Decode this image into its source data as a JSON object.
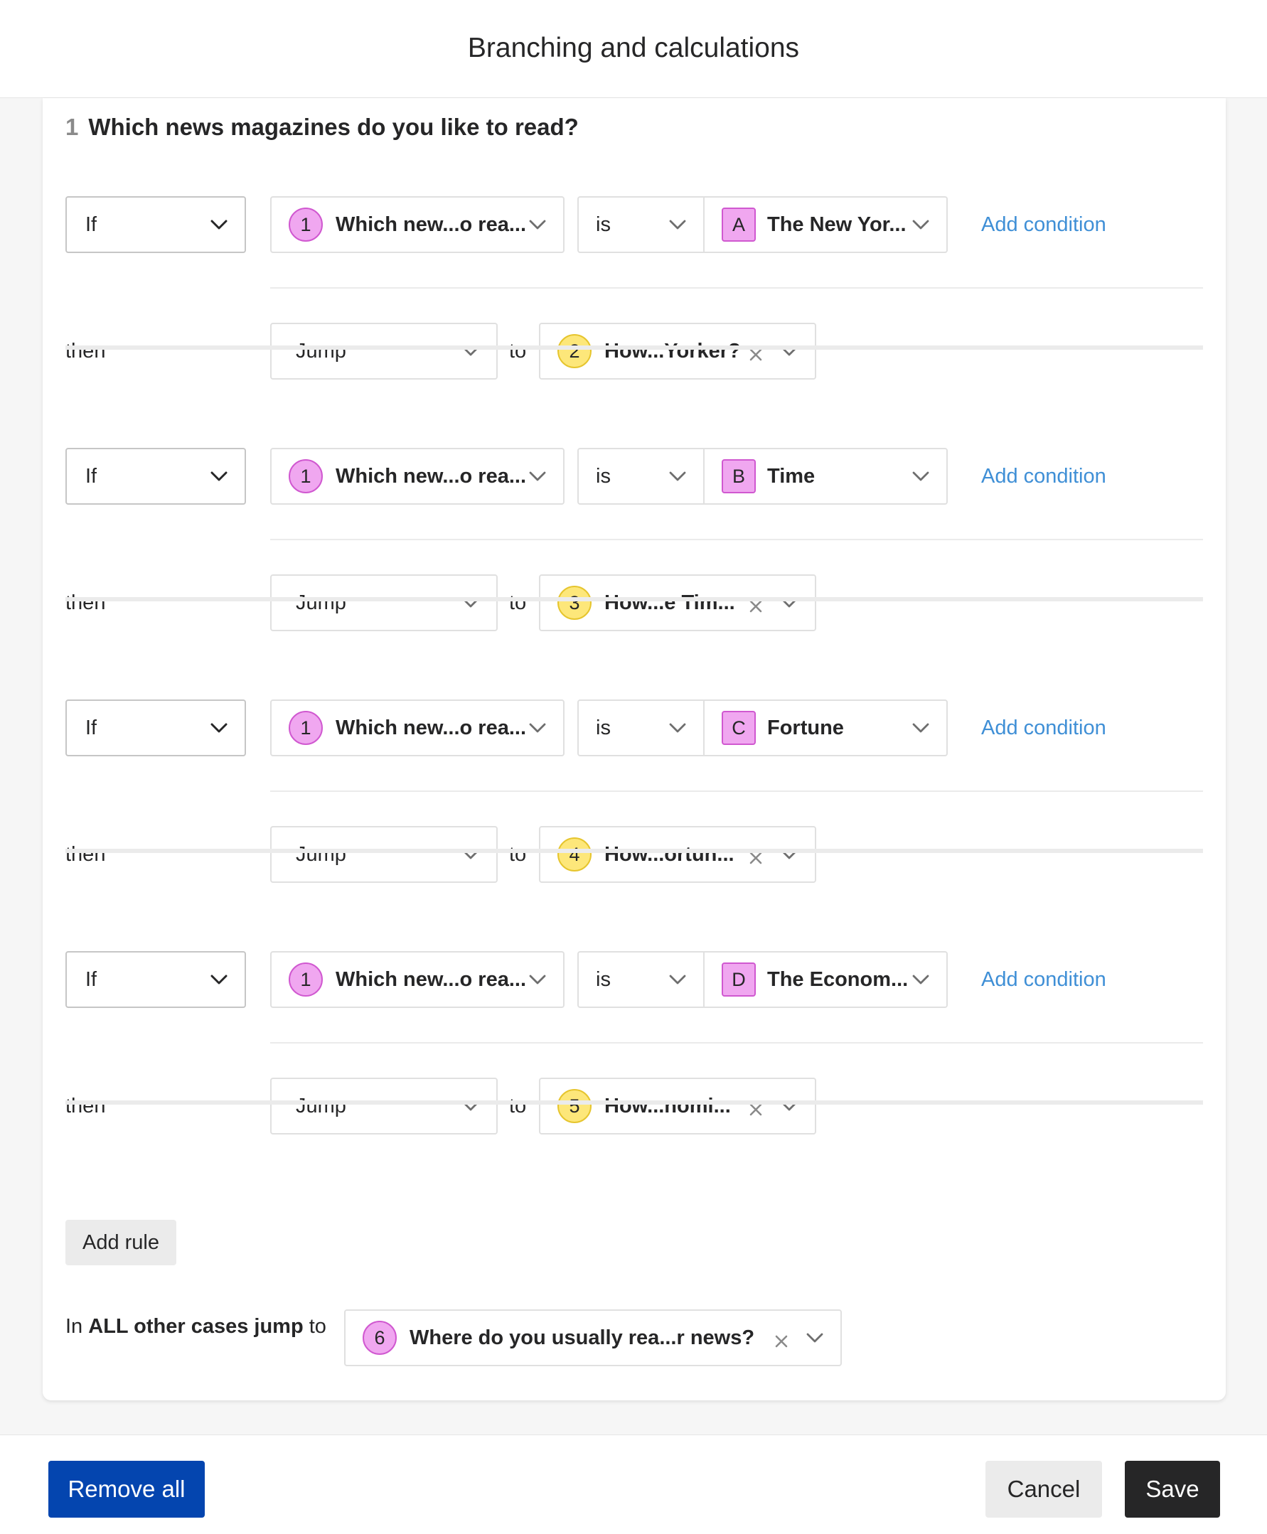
{
  "header": {
    "title": "Branching and calculations"
  },
  "question": {
    "number": "1",
    "text": "Which news magazines do you like to read?"
  },
  "rules": [
    {
      "if_label": "If",
      "field": {
        "num": "1",
        "text": "Which new...o rea..."
      },
      "operator": "is",
      "value": {
        "letter": "A",
        "text": "The New Yor..."
      },
      "add_condition": "Add condition",
      "then_label": "then",
      "action": "Jump",
      "to_label": "to",
      "target": {
        "num": "2",
        "text": "How...Yorker?"
      }
    },
    {
      "if_label": "If",
      "field": {
        "num": "1",
        "text": "Which new...o rea..."
      },
      "operator": "is",
      "value": {
        "letter": "B",
        "text": "Time"
      },
      "add_condition": "Add condition",
      "then_label": "then",
      "action": "Jump",
      "to_label": "to",
      "target": {
        "num": "3",
        "text": "How...e Tim..."
      }
    },
    {
      "if_label": "If",
      "field": {
        "num": "1",
        "text": "Which new...o rea..."
      },
      "operator": "is",
      "value": {
        "letter": "C",
        "text": "Fortune"
      },
      "add_condition": "Add condition",
      "then_label": "then",
      "action": "Jump",
      "to_label": "to",
      "target": {
        "num": "4",
        "text": "How...ortun..."
      }
    },
    {
      "if_label": "If",
      "field": {
        "num": "1",
        "text": "Which new...o rea..."
      },
      "operator": "is",
      "value": {
        "letter": "D",
        "text": "The Econom..."
      },
      "add_condition": "Add condition",
      "then_label": "then",
      "action": "Jump",
      "to_label": "to",
      "target": {
        "num": "5",
        "text": "How...nomi..."
      }
    }
  ],
  "add_rule": "Add rule",
  "fallback": {
    "prefix": "In ",
    "bold": "ALL other cases jump",
    "suffix": " to",
    "target": {
      "num": "6",
      "text": "Where do you usually rea...r news?"
    }
  },
  "footer": {
    "remove_all": "Remove all",
    "cancel": "Cancel",
    "save": "Save"
  },
  "colors": {
    "link": "#3f8fd6",
    "primary": "#0445af",
    "dark": "#262627",
    "pink": "#f0a7f0",
    "yellow": "#fde77a"
  }
}
